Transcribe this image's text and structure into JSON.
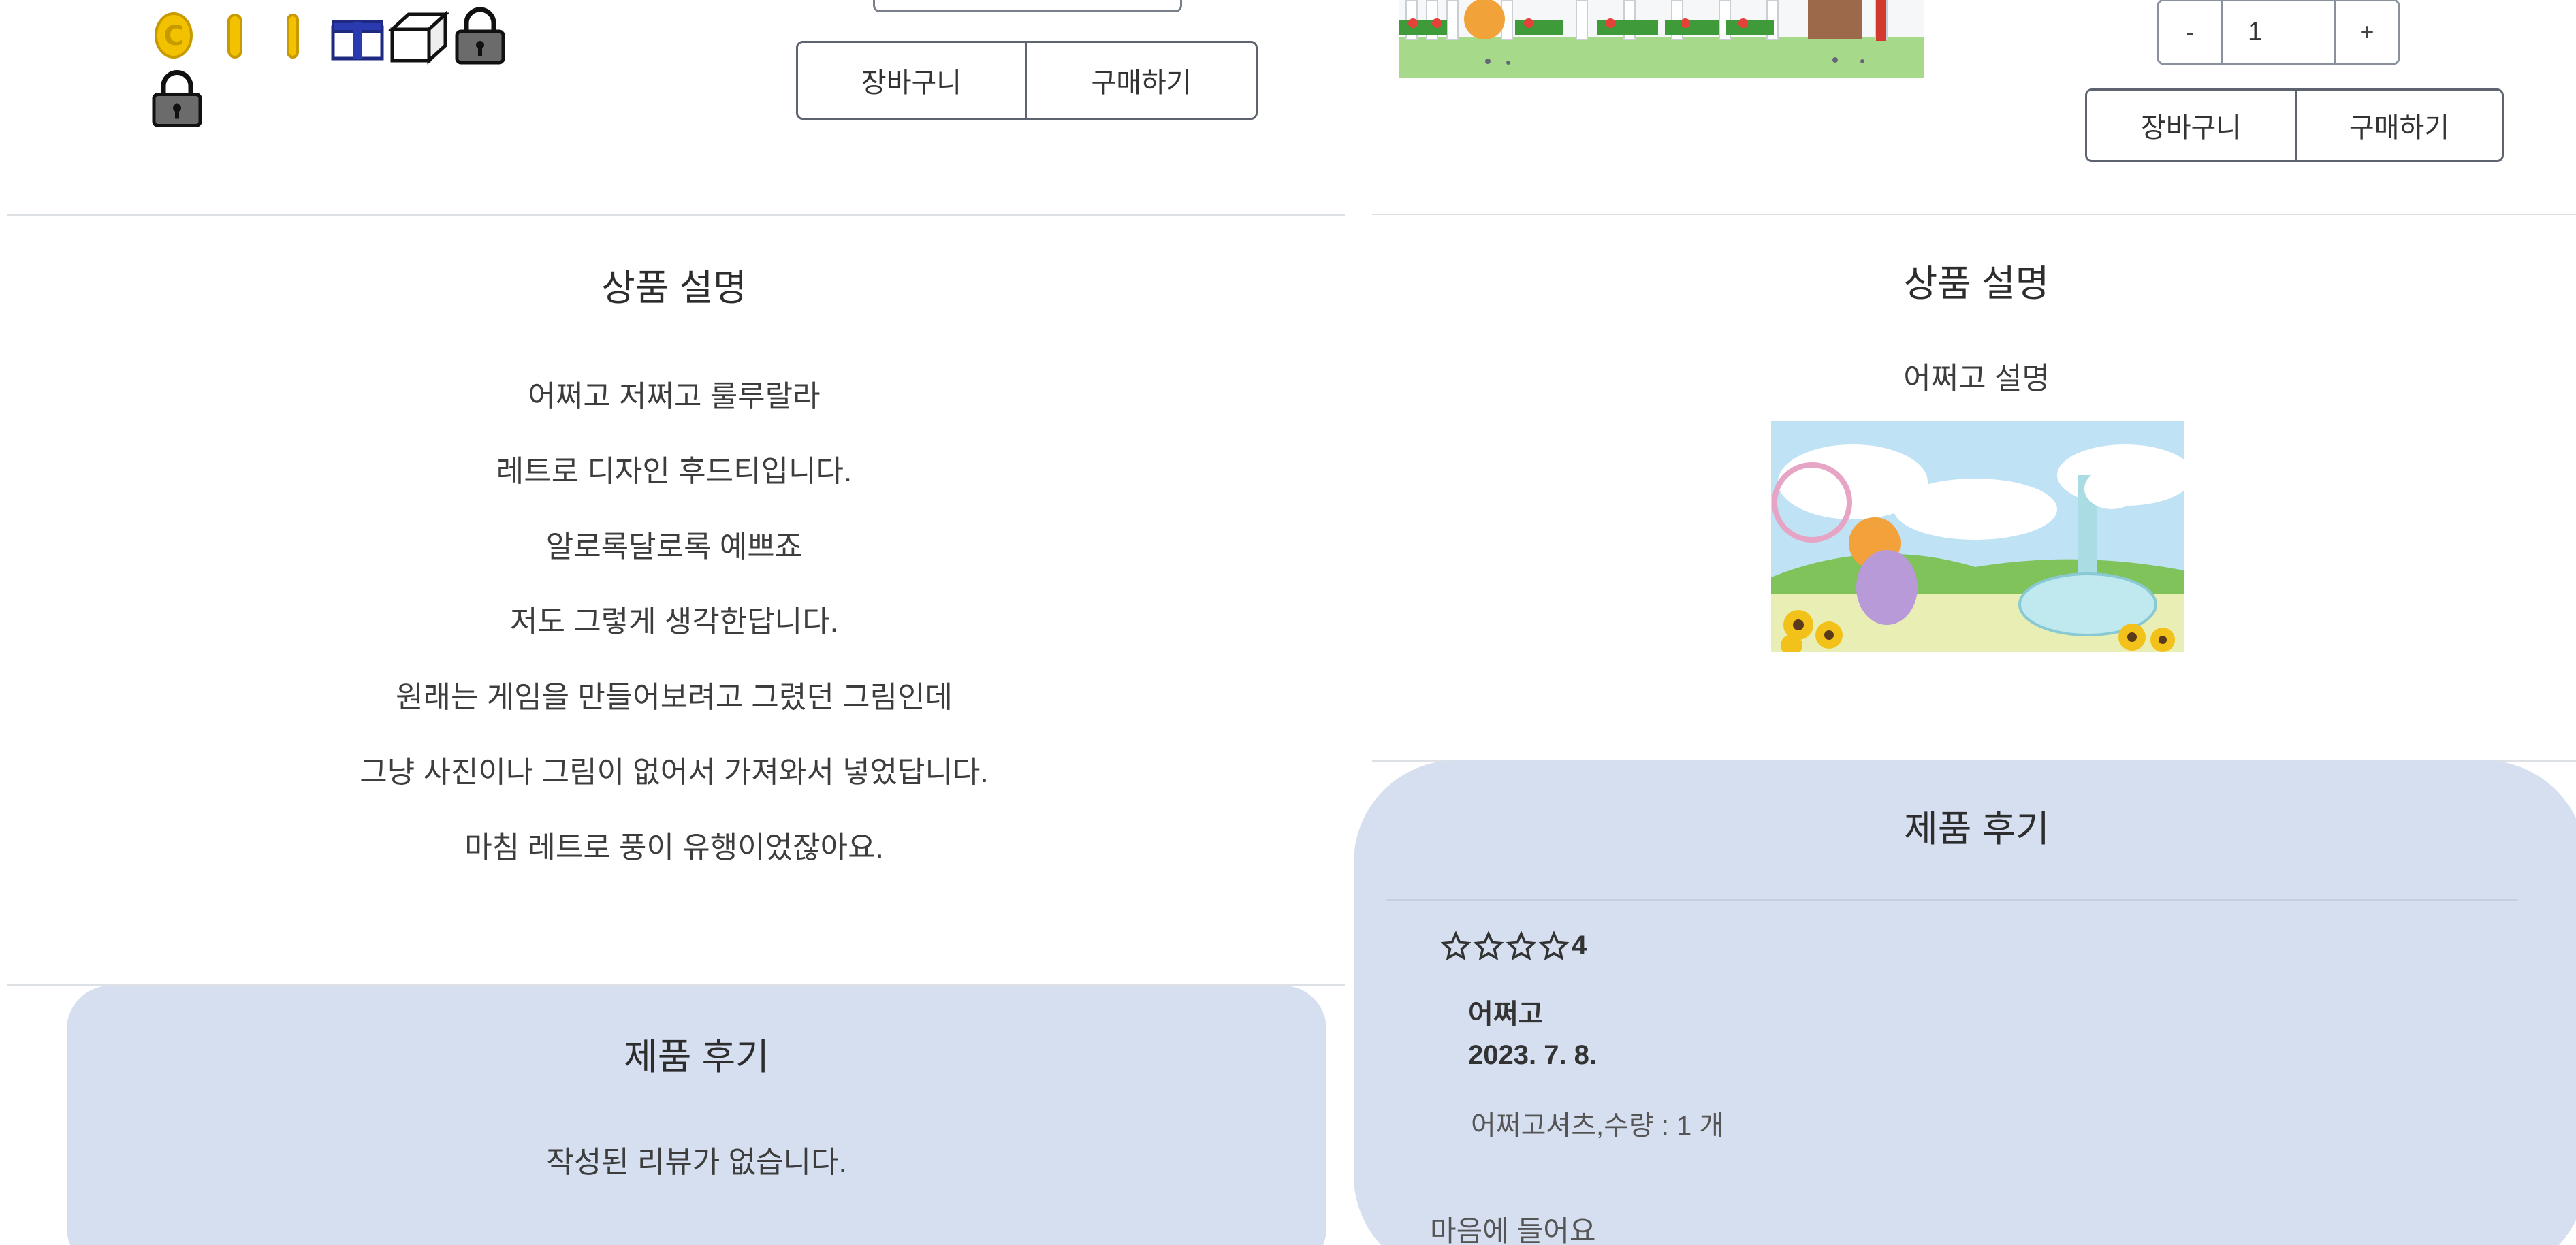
{
  "left": {
    "buttons": {
      "cart": "장바구니",
      "buy": "구매하기"
    },
    "description": {
      "title": "상품 설명",
      "lines": [
        "어쩌고 저쩌고 룰루랄라",
        "레트로 디자인 후드티입니다.",
        "알로록달로록 예쁘죠",
        "저도 그렇게 생각한답니다.",
        "원래는 게임을 만들어보려고 그렸던 그림인데",
        "그냥 사진이나 그림이 없어서 가져와서 넣었답니다.",
        "마침 레트로 풍이 유행이었잖아요."
      ]
    },
    "reviews": {
      "title": "제품 후기",
      "empty_text": "작성된 리뷰가 없습니다."
    }
  },
  "right": {
    "quantity": {
      "minus": "-",
      "value": "1",
      "plus": "+"
    },
    "buttons": {
      "cart": "장바구니",
      "buy": "구매하기"
    },
    "description": {
      "title": "상품 설명",
      "text": "어쩌고 설명"
    },
    "reviews": {
      "title": "제품 후기",
      "items": [
        {
          "rating": "4",
          "author": "어쩌고",
          "date": "2023. 7. 8.",
          "product": "어쩌고셔츠,수량 : 1 개",
          "content": "마음에 들어요"
        }
      ]
    }
  },
  "colors": {
    "review_bg": "#d6dff0",
    "coin": "#f2c200",
    "lock": "#6b6b6b"
  }
}
